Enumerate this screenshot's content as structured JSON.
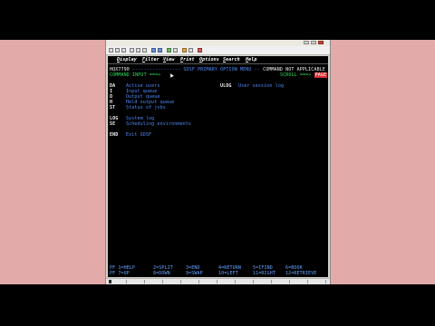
{
  "colors": {
    "backdrop": "#e2aaa8",
    "terminal_bg": "#000000",
    "field_blue": "#4f8cff",
    "highlight_green": "#2ee05a",
    "scroll_red": "#d83030"
  },
  "menu": {
    "items": [
      {
        "hot": "D",
        "rest": "isplay"
      },
      {
        "hot": "F",
        "rest": "ilter"
      },
      {
        "hot": "V",
        "rest": "iew"
      },
      {
        "hot": "P",
        "rest": "rint"
      },
      {
        "hot": "O",
        "rest": "ptions"
      },
      {
        "hot": "S",
        "rest": "earch"
      },
      {
        "hot": "H",
        "rest": "elp"
      }
    ]
  },
  "header": {
    "panel_id": "HQX7790",
    "dashes_left": " -----------------",
    "title": "SDSF PRIMARY OPTION MENU",
    "dashes_right": " -- ",
    "message": "COMMAND NOT APPLICABLE",
    "command_label": "COMMAND INPUT ===>",
    "scroll_label": "SCROLL ===>",
    "scroll_value": "PAGE"
  },
  "options_left": [
    {
      "code": "DA",
      "label": "Active users"
    },
    {
      "code": "I",
      "label": "Input queue"
    },
    {
      "code": "O",
      "label": "Output queue"
    },
    {
      "code": "H",
      "label": "Held output queue"
    },
    {
      "code": "ST",
      "label": "Status of jobs"
    }
  ],
  "options_right": [
    {
      "code": "ULOG",
      "label": "User session log"
    }
  ],
  "options_group2": [
    {
      "code": "LOG",
      "label": "System log"
    },
    {
      "code": "SE",
      "label": "Scheduling environments"
    }
  ],
  "options_group3": [
    {
      "code": "END",
      "label": "Exit SDSF"
    }
  ],
  "pf_keys": {
    "row1": [
      {
        "key": "PF 1=HELP"
      },
      {
        "key": "2=SPLIT"
      },
      {
        "key": "3=END"
      },
      {
        "key": "4=RETURN"
      },
      {
        "key": "5=IFIND"
      },
      {
        "key": "6=BOOK"
      }
    ],
    "row2": [
      {
        "key": "PF 7=UP"
      },
      {
        "key": "8=DOWN"
      },
      {
        "key": "9=SWAP"
      },
      {
        "key": "10=LEFT"
      },
      {
        "key": "11=RIGHT"
      },
      {
        "key": "12=RETRIEVE"
      }
    ]
  },
  "icons": {
    "title_controls": [
      "minimize-icon",
      "maximize-icon",
      "close-icon"
    ],
    "toolbar": [
      "new-session-icon",
      "open-icon",
      "save-icon",
      "print-icon",
      "copy-icon",
      "paste-icon",
      "send-icon",
      "receive-icon",
      "macro-icon",
      "keypad-icon",
      "color-icon",
      "settings-icon",
      "help-icon"
    ]
  }
}
